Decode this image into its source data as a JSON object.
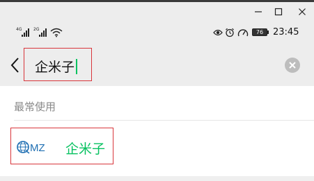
{
  "window": {
    "minimize_icon": "minimize-icon",
    "maximize_icon": "maximize-icon",
    "close_icon": "close-icon"
  },
  "status_bar": {
    "signal_1_tag": "4G",
    "signal_2_tag": "2G",
    "icons": [
      "wifi-icon",
      "eye-icon",
      "alarm-icon",
      "speedometer-icon"
    ],
    "battery": "76",
    "time": "23:45"
  },
  "search": {
    "query": "企米子",
    "back_icon": "back-arrow-icon",
    "clear_icon": "clear-icon",
    "cursor_color": "#07c160"
  },
  "results": {
    "section_title": "最常使用",
    "items": [
      {
        "logo_text": "MZ",
        "name": "企米子"
      }
    ]
  },
  "colors": {
    "accent_green": "#07c160",
    "highlight_red": "#d8343a"
  }
}
